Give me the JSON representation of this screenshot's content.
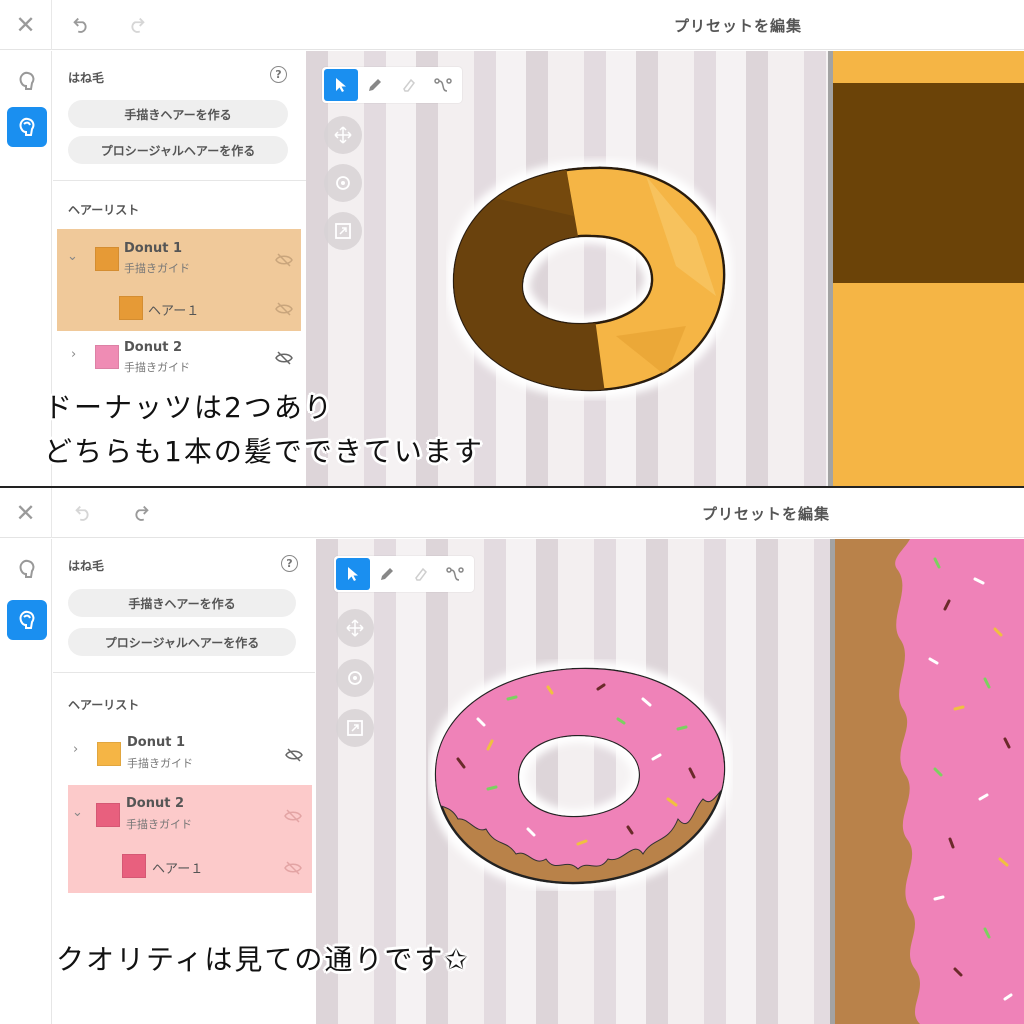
{
  "colors": {
    "accent": "#1a8ff0",
    "chocolate": "#6b4308",
    "dough": "#f5b545",
    "pink_icing": "#ef82b8",
    "donut_base": "#b9824a"
  },
  "top": {
    "titlebar": {
      "close": "✕",
      "title": "プリセットを編集"
    },
    "sidebar": {
      "section_title": "はね毛",
      "help": "?",
      "btn_hand": "手描きヘアーを作る",
      "btn_proc": "プロシージャルヘアーを作る",
      "list_title": "ヘアーリスト",
      "items": [
        {
          "name": "Donut 1",
          "sub": "手描きガイド",
          "swatch": "#e69a36",
          "selected": true
        },
        {
          "name": "ヘアー１",
          "swatch": "#e69a36"
        },
        {
          "name": "Donut 2",
          "sub": "手描きガイド",
          "swatch": "#ef8cb4"
        }
      ]
    },
    "caption_line1": "ドーナッツは2つあり",
    "caption_line2": "どちらも1本の髪でできています"
  },
  "bottom": {
    "titlebar": {
      "close": "✕",
      "title": "プリセットを編集"
    },
    "sidebar": {
      "section_title": "はね毛",
      "help": "?",
      "btn_hand": "手描きヘアーを作る",
      "btn_proc": "プロシージャルヘアーを作る",
      "list_title": "ヘアーリスト",
      "items": [
        {
          "name": "Donut 1",
          "sub": "手描きガイド",
          "swatch": "#f5b545"
        },
        {
          "name": "Donut 2",
          "sub": "手描きガイド",
          "swatch": "#e8607e",
          "selected": true
        },
        {
          "name": "ヘアー１",
          "swatch": "#e8607e"
        }
      ]
    },
    "caption": "クオリティは見ての通りです✩"
  }
}
